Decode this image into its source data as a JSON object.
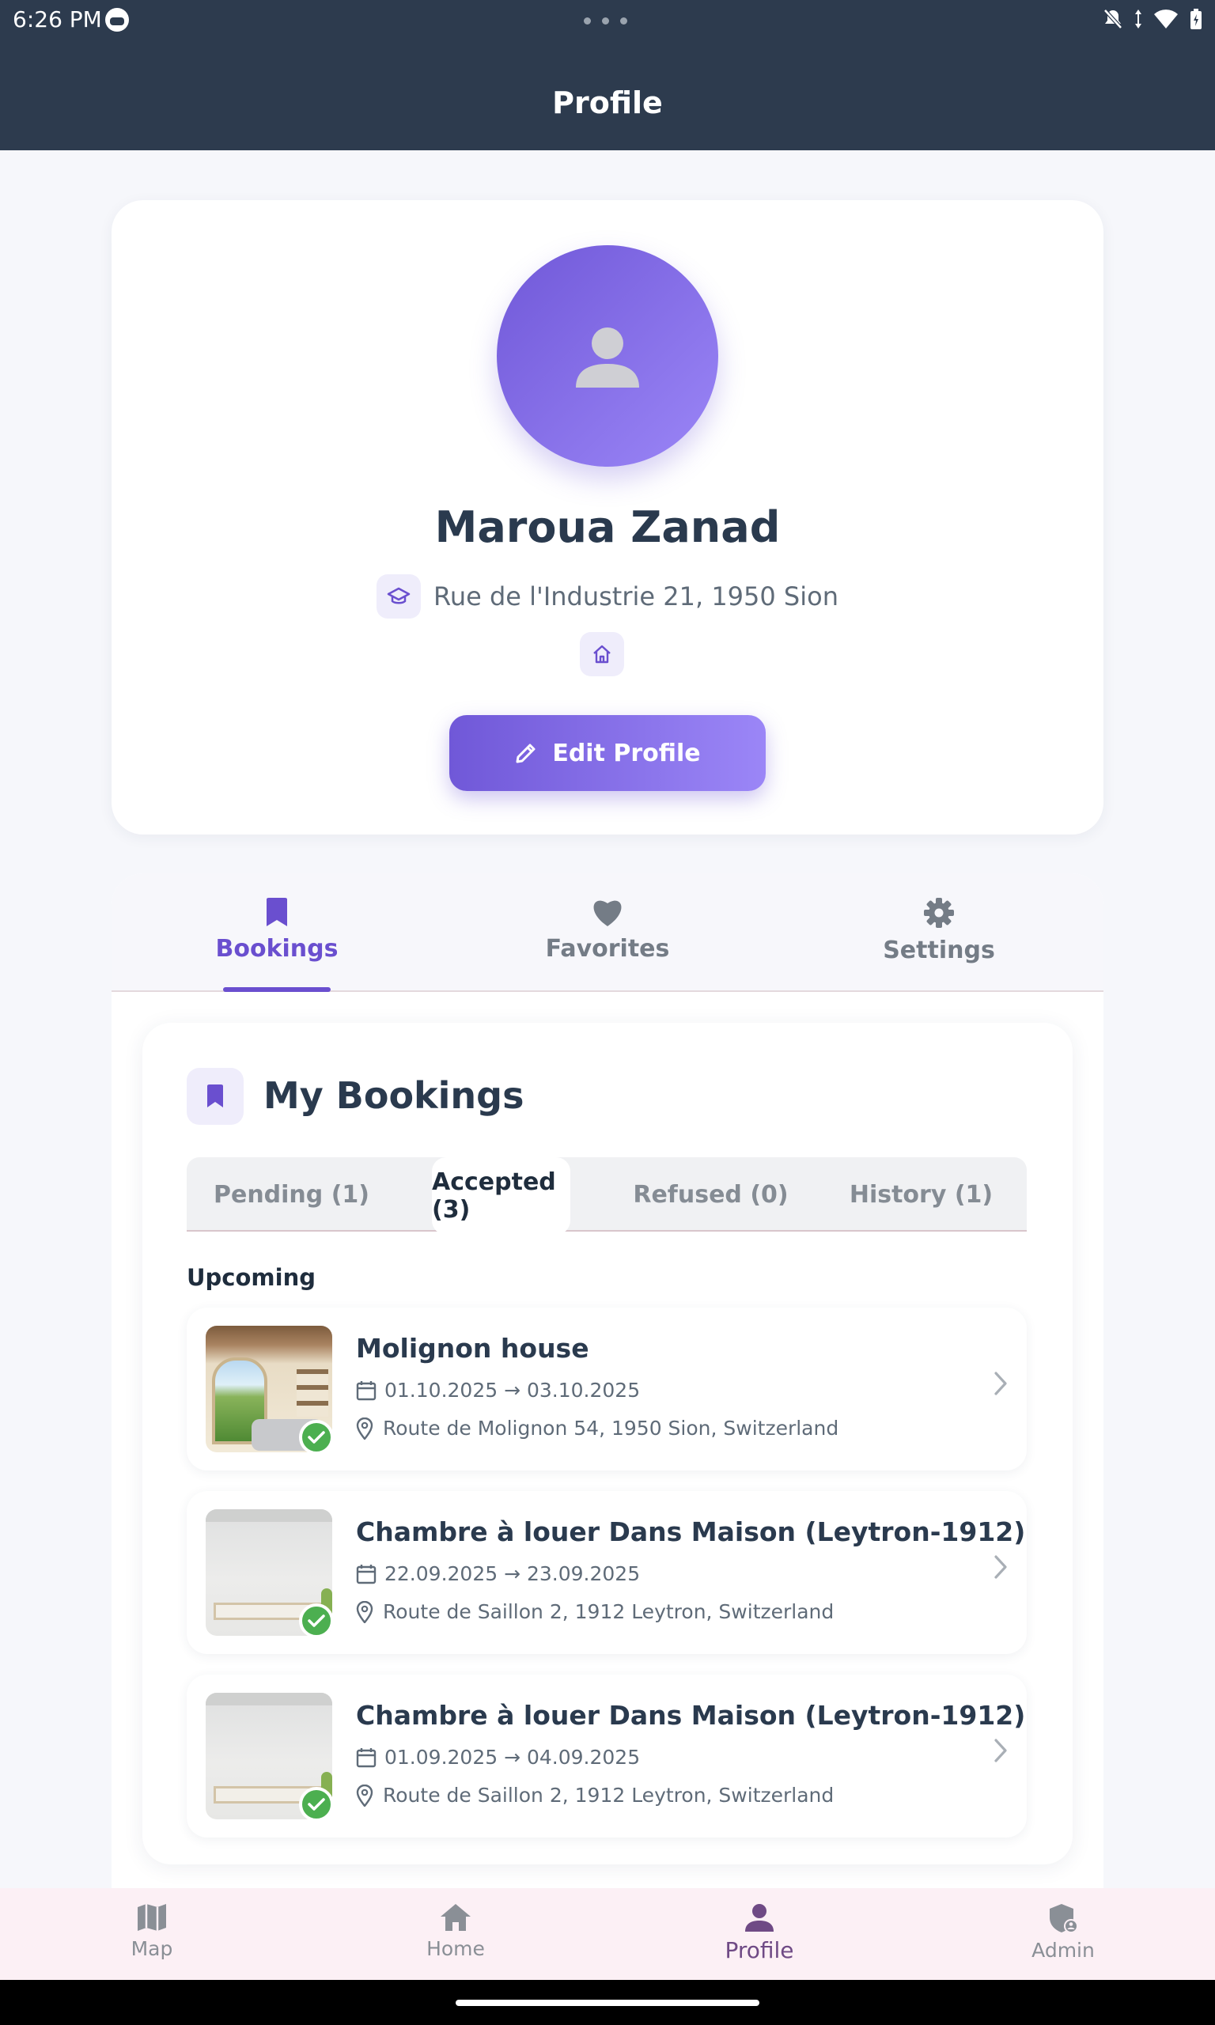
{
  "status_bar": {
    "time": "6:26 PM"
  },
  "app_bar": {
    "title": "Profile"
  },
  "profile": {
    "name": "Maroua Zanad",
    "address": "Rue de l'Industrie 21, 1950 Sion",
    "edit_label": "Edit Profile"
  },
  "tabs": [
    {
      "label": "Bookings",
      "icon": "bookmark-icon",
      "active": true
    },
    {
      "label": "Favorites",
      "icon": "heart-icon",
      "active": false
    },
    {
      "label": "Settings",
      "icon": "gear-icon",
      "active": false
    }
  ],
  "bookings": {
    "title": "My Bookings",
    "subtabs": [
      {
        "label": "Pending (1)",
        "active": false
      },
      {
        "label": "Accepted (3)",
        "active": true
      },
      {
        "label": "Refused (0)",
        "active": false
      },
      {
        "label": "History (1)",
        "active": false
      }
    ],
    "section_label": "Upcoming",
    "items": [
      {
        "name": "Molignon house",
        "dates": "01.10.2025 → 03.10.2025",
        "address": "Route de Molignon 54, 1950 Sion, Switzerland",
        "status": "accepted"
      },
      {
        "name": "Chambre à louer Dans Maison (Leytron-1912)",
        "dates": "22.09.2025 → 23.09.2025",
        "address": "Route de Saillon 2, 1912 Leytron, Switzerland",
        "status": "accepted"
      },
      {
        "name": "Chambre à louer Dans Maison (Leytron-1912)",
        "dates": "01.09.2025 → 04.09.2025",
        "address": "Route de Saillon 2, 1912 Leytron, Switzerland",
        "status": "accepted"
      }
    ]
  },
  "bottom_nav": [
    {
      "label": "Map",
      "icon": "map-icon",
      "active": false
    },
    {
      "label": "Home",
      "icon": "home-icon",
      "active": false
    },
    {
      "label": "Profile",
      "icon": "person-icon",
      "active": true
    },
    {
      "label": "Admin",
      "icon": "admin-shield-icon",
      "active": false
    }
  ],
  "colors": {
    "primary": "#6a4fcf",
    "app_bar": "#2d3b4e",
    "success": "#4caf50",
    "nav_bg": "#fcf0f5"
  }
}
